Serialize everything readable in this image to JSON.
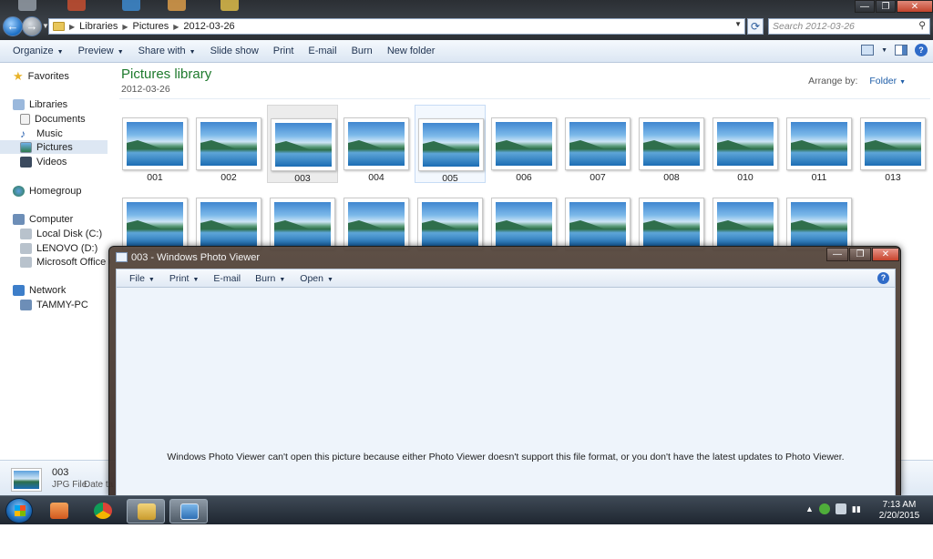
{
  "address": {
    "crumbs": [
      "Libraries",
      "Pictures",
      "2012-03-26"
    ],
    "search_placeholder": "Search 2012-03-26"
  },
  "window_controls": {
    "minimize": "—",
    "maximize": "❐",
    "close": "✕"
  },
  "toolbar": {
    "organize": "Organize",
    "preview": "Preview",
    "share_with": "Share with",
    "slide_show": "Slide show",
    "print": "Print",
    "email": "E-mail",
    "burn": "Burn",
    "new_folder": "New folder"
  },
  "nav": {
    "favorites": "Favorites",
    "libraries": "Libraries",
    "documents": "Documents",
    "music": "Music",
    "pictures": "Pictures",
    "videos": "Videos",
    "homegroup": "Homegroup",
    "computer": "Computer",
    "local_disk": "Local Disk (C:)",
    "lenovo": "LENOVO (D:)",
    "office": "Microsoft Office Click",
    "network": "Network",
    "tammy_pc": "TAMMY-PC"
  },
  "library": {
    "title": "Pictures library",
    "subtitle": "2012-03-26",
    "arrange_by_label": "Arrange by:",
    "arrange_by_value": "Folder"
  },
  "files_row1": [
    "001",
    "002",
    "003",
    "004",
    "005",
    "006",
    "007",
    "008",
    "010",
    "011",
    "013"
  ],
  "details": {
    "name": "003",
    "type": "JPG File",
    "date_label": "Date ta"
  },
  "photo_viewer": {
    "title": "003 - Windows Photo Viewer",
    "menu": {
      "file": "File",
      "print": "Print",
      "email": "E-mail",
      "burn": "Burn",
      "open": "Open"
    },
    "message": "Windows Photo Viewer can't open this picture because either Photo Viewer doesn't support this file format, or you don't have the latest updates to Photo Viewer."
  },
  "taskbar": {
    "time": "7:13 AM",
    "date": "2/20/2015"
  }
}
